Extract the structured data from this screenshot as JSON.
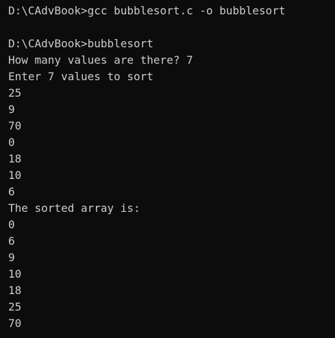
{
  "console": {
    "lines": [
      "D:\\CAdvBook>gcc bubblesort.c -o bubblesort",
      "",
      "D:\\CAdvBook>bubblesort",
      "How many values are there? 7",
      "Enter 7 values to sort",
      "25",
      "9",
      "70",
      "0",
      "18",
      "10",
      "6",
      "The sorted array is:",
      "0",
      "6",
      "9",
      "10",
      "18",
      "25",
      "70"
    ],
    "colors": {
      "background": "#0c0c0c",
      "text": "#cccccc"
    }
  }
}
